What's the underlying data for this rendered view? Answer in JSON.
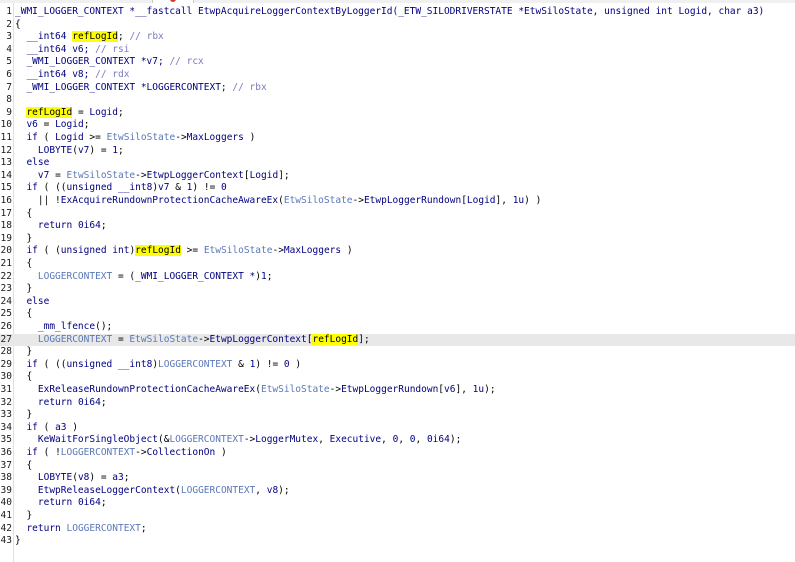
{
  "editor": {
    "highlight_token": "refLogId",
    "current_line": 27
  },
  "lines": [
    {
      "n": "1",
      "segs": [
        [
          "tp",
          "_WMI_LOGGER_CONTEXT *__fastcall EtwpAcquireLoggerContextByLoggerId(_ETW_SILODRIVERSTATE *EtwSiloState, unsigned int Logid, char a3)"
        ]
      ]
    },
    {
      "n": "2",
      "segs": [
        [
          "p",
          "{"
        ]
      ]
    },
    {
      "n": "3",
      "segs": [
        [
          "ind",
          "  "
        ],
        [
          "ty",
          "__int64 "
        ],
        [
          "hl",
          "refLogId"
        ],
        [
          "p",
          "; "
        ],
        [
          "cm",
          "// rbx"
        ]
      ]
    },
    {
      "n": "4",
      "segs": [
        [
          "ind",
          "  "
        ],
        [
          "ty",
          "__int64 v6; "
        ],
        [
          "cm",
          "// rsi"
        ]
      ]
    },
    {
      "n": "5",
      "segs": [
        [
          "ind",
          "  "
        ],
        [
          "ty",
          "_WMI_LOGGER_CONTEXT *v7; "
        ],
        [
          "cm",
          "// rcx"
        ]
      ]
    },
    {
      "n": "6",
      "segs": [
        [
          "ind",
          "  "
        ],
        [
          "ty",
          "__int64 v8; "
        ],
        [
          "cm",
          "// rdx"
        ]
      ]
    },
    {
      "n": "7",
      "segs": [
        [
          "ind",
          "  "
        ],
        [
          "ty",
          "_WMI_LOGGER_CONTEXT *LOGGERCONTEXT; "
        ],
        [
          "cm",
          "// rbx"
        ]
      ]
    },
    {
      "n": "8",
      "segs": []
    },
    {
      "n": "9",
      "segs": [
        [
          "ind",
          "  "
        ],
        [
          "hl",
          "refLogId"
        ],
        [
          "p",
          " = "
        ],
        [
          "arg",
          "Logid"
        ],
        [
          "p",
          ";"
        ]
      ]
    },
    {
      "n": "10",
      "segs": [
        [
          "ind",
          "  "
        ],
        [
          "loc",
          "v6"
        ],
        [
          "p",
          " = "
        ],
        [
          "arg",
          "Logid"
        ],
        [
          "p",
          ";"
        ]
      ]
    },
    {
      "n": "11",
      "segs": [
        [
          "ind",
          "  "
        ],
        [
          "kw",
          "if"
        ],
        [
          "p",
          " ( "
        ],
        [
          "arg",
          "Logid"
        ],
        [
          "p",
          " >= "
        ],
        [
          "gv",
          "EtwSiloState"
        ],
        [
          "p",
          "->"
        ],
        [
          "fld",
          "MaxLoggers"
        ],
        [
          "p",
          " )"
        ]
      ]
    },
    {
      "n": "12",
      "segs": [
        [
          "ind",
          "    "
        ],
        [
          "fn",
          "LOBYTE"
        ],
        [
          "p",
          "("
        ],
        [
          "loc",
          "v7"
        ],
        [
          "p",
          ") = "
        ],
        [
          "num",
          "1"
        ],
        [
          "p",
          ";"
        ]
      ]
    },
    {
      "n": "13",
      "segs": [
        [
          "ind",
          "  "
        ],
        [
          "kw",
          "else"
        ]
      ]
    },
    {
      "n": "14",
      "segs": [
        [
          "ind",
          "    "
        ],
        [
          "loc",
          "v7"
        ],
        [
          "p",
          " = "
        ],
        [
          "gv",
          "EtwSiloState"
        ],
        [
          "p",
          "->"
        ],
        [
          "fld",
          "EtwpLoggerContext"
        ],
        [
          "p",
          "["
        ],
        [
          "arg",
          "Logid"
        ],
        [
          "p",
          "];"
        ]
      ]
    },
    {
      "n": "15",
      "segs": [
        [
          "ind",
          "  "
        ],
        [
          "kw",
          "if"
        ],
        [
          "p",
          " ( (("
        ],
        [
          "ty",
          "unsigned __int8"
        ],
        [
          "p",
          ")"
        ],
        [
          "loc",
          "v7"
        ],
        [
          "p",
          " & "
        ],
        [
          "num",
          "1"
        ],
        [
          "p",
          ") != "
        ],
        [
          "num",
          "0"
        ]
      ]
    },
    {
      "n": "16",
      "segs": [
        [
          "ind",
          "    "
        ],
        [
          "p",
          "|| !"
        ],
        [
          "fn",
          "ExAcquireRundownProtectionCacheAwareEx"
        ],
        [
          "p",
          "("
        ],
        [
          "gv",
          "EtwSiloState"
        ],
        [
          "p",
          "->"
        ],
        [
          "fld",
          "EtwpLoggerRundown"
        ],
        [
          "p",
          "["
        ],
        [
          "arg",
          "Logid"
        ],
        [
          "p",
          "], "
        ],
        [
          "num",
          "1u"
        ],
        [
          "p",
          ") )"
        ]
      ]
    },
    {
      "n": "17",
      "segs": [
        [
          "ind",
          "  "
        ],
        [
          "p",
          "{"
        ]
      ]
    },
    {
      "n": "18",
      "segs": [
        [
          "ind",
          "    "
        ],
        [
          "kw",
          "return"
        ],
        [
          "p",
          " "
        ],
        [
          "num",
          "0i64"
        ],
        [
          "p",
          ";"
        ]
      ]
    },
    {
      "n": "19",
      "segs": [
        [
          "ind",
          "  "
        ],
        [
          "p",
          "}"
        ]
      ]
    },
    {
      "n": "20",
      "segs": [
        [
          "ind",
          "  "
        ],
        [
          "kw",
          "if"
        ],
        [
          "p",
          " ( ("
        ],
        [
          "ty",
          "unsigned int"
        ],
        [
          "p",
          ")"
        ],
        [
          "hl",
          "refLogId"
        ],
        [
          "p",
          " >= "
        ],
        [
          "gv",
          "EtwSiloState"
        ],
        [
          "p",
          "->"
        ],
        [
          "fld",
          "MaxLoggers"
        ],
        [
          "p",
          " )"
        ]
      ]
    },
    {
      "n": "21",
      "segs": [
        [
          "ind",
          "  "
        ],
        [
          "p",
          "{"
        ]
      ]
    },
    {
      "n": "22",
      "segs": [
        [
          "ind",
          "    "
        ],
        [
          "gv",
          "LOGGERCONTEXT"
        ],
        [
          "p",
          " = ("
        ],
        [
          "ty",
          "_WMI_LOGGER_CONTEXT *"
        ],
        [
          "p",
          ")"
        ],
        [
          "num",
          "1"
        ],
        [
          "p",
          ";"
        ]
      ]
    },
    {
      "n": "23",
      "segs": [
        [
          "ind",
          "  "
        ],
        [
          "p",
          "}"
        ]
      ]
    },
    {
      "n": "24",
      "segs": [
        [
          "ind",
          "  "
        ],
        [
          "kw",
          "else"
        ]
      ]
    },
    {
      "n": "25",
      "segs": [
        [
          "ind",
          "  "
        ],
        [
          "p",
          "{"
        ]
      ]
    },
    {
      "n": "26",
      "segs": [
        [
          "ind",
          "    "
        ],
        [
          "fn",
          "_mm_lfence"
        ],
        [
          "p",
          "();"
        ]
      ]
    },
    {
      "n": "27",
      "segs": [
        [
          "ind",
          "    "
        ],
        [
          "gv",
          "LOGGERCONTEXT"
        ],
        [
          "p",
          " = "
        ],
        [
          "gv",
          "EtwSiloState"
        ],
        [
          "p",
          "->"
        ],
        [
          "fld",
          "EtwpLoggerContext"
        ],
        [
          "p",
          "["
        ],
        [
          "hl",
          "refLogId"
        ],
        [
          "p",
          "];"
        ]
      ]
    },
    {
      "n": "28",
      "segs": [
        [
          "ind",
          "  "
        ],
        [
          "p",
          "}"
        ]
      ]
    },
    {
      "n": "29",
      "segs": [
        [
          "ind",
          "  "
        ],
        [
          "kw",
          "if"
        ],
        [
          "p",
          " ( (("
        ],
        [
          "ty",
          "unsigned __int8"
        ],
        [
          "p",
          ")"
        ],
        [
          "gv",
          "LOGGERCONTEXT"
        ],
        [
          "p",
          " & "
        ],
        [
          "num",
          "1"
        ],
        [
          "p",
          ") != "
        ],
        [
          "num",
          "0"
        ],
        [
          "p",
          " )"
        ]
      ]
    },
    {
      "n": "30",
      "segs": [
        [
          "ind",
          "  "
        ],
        [
          "p",
          "{"
        ]
      ]
    },
    {
      "n": "31",
      "segs": [
        [
          "ind",
          "    "
        ],
        [
          "fn",
          "ExReleaseRundownProtectionCacheAwareEx"
        ],
        [
          "p",
          "("
        ],
        [
          "gv",
          "EtwSiloState"
        ],
        [
          "p",
          "->"
        ],
        [
          "fld",
          "EtwpLoggerRundown"
        ],
        [
          "p",
          "["
        ],
        [
          "loc",
          "v6"
        ],
        [
          "p",
          "], "
        ],
        [
          "num",
          "1u"
        ],
        [
          "p",
          ");"
        ]
      ]
    },
    {
      "n": "32",
      "segs": [
        [
          "ind",
          "    "
        ],
        [
          "kw",
          "return"
        ],
        [
          "p",
          " "
        ],
        [
          "num",
          "0i64"
        ],
        [
          "p",
          ";"
        ]
      ]
    },
    {
      "n": "33",
      "segs": [
        [
          "ind",
          "  "
        ],
        [
          "p",
          "}"
        ]
      ]
    },
    {
      "n": "34",
      "segs": [
        [
          "ind",
          "  "
        ],
        [
          "kw",
          "if"
        ],
        [
          "p",
          " ( "
        ],
        [
          "arg",
          "a3"
        ],
        [
          "p",
          " )"
        ]
      ]
    },
    {
      "n": "35",
      "segs": [
        [
          "ind",
          "    "
        ],
        [
          "fn",
          "KeWaitForSingleObject"
        ],
        [
          "p",
          "(&"
        ],
        [
          "gv",
          "LOGGERCONTEXT"
        ],
        [
          "p",
          "->"
        ],
        [
          "fld",
          "LoggerMutex"
        ],
        [
          "p",
          ", "
        ],
        [
          "num",
          "Executive"
        ],
        [
          "p",
          ", "
        ],
        [
          "num",
          "0"
        ],
        [
          "p",
          ", "
        ],
        [
          "num",
          "0"
        ],
        [
          "p",
          ", "
        ],
        [
          "num",
          "0i64"
        ],
        [
          "p",
          ");"
        ]
      ]
    },
    {
      "n": "36",
      "segs": [
        [
          "ind",
          "  "
        ],
        [
          "kw",
          "if"
        ],
        [
          "p",
          " ( !"
        ],
        [
          "gv",
          "LOGGERCONTEXT"
        ],
        [
          "p",
          "->"
        ],
        [
          "fld",
          "CollectionOn"
        ],
        [
          "p",
          " )"
        ]
      ]
    },
    {
      "n": "37",
      "segs": [
        [
          "ind",
          "  "
        ],
        [
          "p",
          "{"
        ]
      ]
    },
    {
      "n": "38",
      "segs": [
        [
          "ind",
          "    "
        ],
        [
          "fn",
          "LOBYTE"
        ],
        [
          "p",
          "("
        ],
        [
          "loc",
          "v8"
        ],
        [
          "p",
          ") = "
        ],
        [
          "arg",
          "a3"
        ],
        [
          "p",
          ";"
        ]
      ]
    },
    {
      "n": "39",
      "segs": [
        [
          "ind",
          "    "
        ],
        [
          "fn",
          "EtwpReleaseLoggerContext"
        ],
        [
          "p",
          "("
        ],
        [
          "gv",
          "LOGGERCONTEXT"
        ],
        [
          "p",
          ", "
        ],
        [
          "loc",
          "v8"
        ],
        [
          "p",
          ");"
        ]
      ]
    },
    {
      "n": "40",
      "segs": [
        [
          "ind",
          "    "
        ],
        [
          "kw",
          "return"
        ],
        [
          "p",
          " "
        ],
        [
          "num",
          "0i64"
        ],
        [
          "p",
          ";"
        ]
      ]
    },
    {
      "n": "41",
      "segs": [
        [
          "ind",
          "  "
        ],
        [
          "p",
          "}"
        ]
      ]
    },
    {
      "n": "42",
      "segs": [
        [
          "ind",
          "  "
        ],
        [
          "kw",
          "return"
        ],
        [
          "p",
          " "
        ],
        [
          "gv",
          "LOGGERCONTEXT"
        ],
        [
          "p",
          ";"
        ]
      ]
    },
    {
      "n": "43",
      "segs": [
        [
          "p",
          "}"
        ]
      ]
    }
  ]
}
